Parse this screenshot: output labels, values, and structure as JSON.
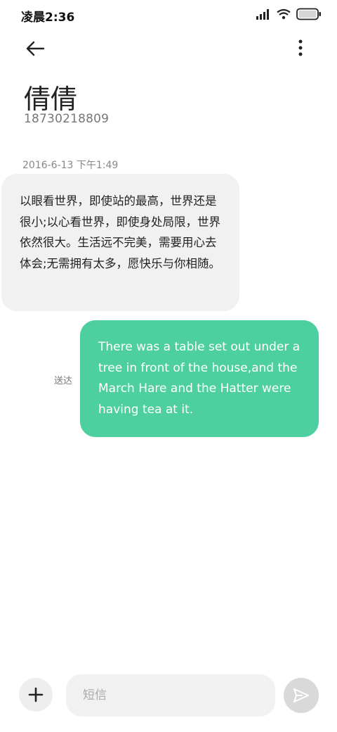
{
  "status_bar": {
    "time": "凌晨2:36",
    "icons": [
      "signal-icon",
      "wifi-icon",
      "battery-icon"
    ]
  },
  "top_bar": {
    "back_icon": "arrow-left-icon",
    "more_icon": "more-vertical-icon"
  },
  "contact": {
    "name": "倩倩",
    "number": "18730218809"
  },
  "conversation": {
    "timestamp": "2016-6-13 下午1:49",
    "incoming_message": "以眼看世界，即使站的最高，世界还是很小;以心看世界，即使身处局限，世界依然很大。生活远不完美，需要用心去体会;无需拥有太多，愿快乐与你相随。",
    "outgoing_message": "There was a table set out under a tree in front of the house,and the March Hare and the Hatter were having tea at it.",
    "outgoing_status": "送达"
  },
  "composer": {
    "add_icon": "plus-icon",
    "placeholder": "短信",
    "send_icon": "send-icon"
  },
  "colors": {
    "outgoing_bubble": "#4dcfa0",
    "incoming_bubble": "#f1f1f1",
    "send_button": "#d9d9d9"
  }
}
